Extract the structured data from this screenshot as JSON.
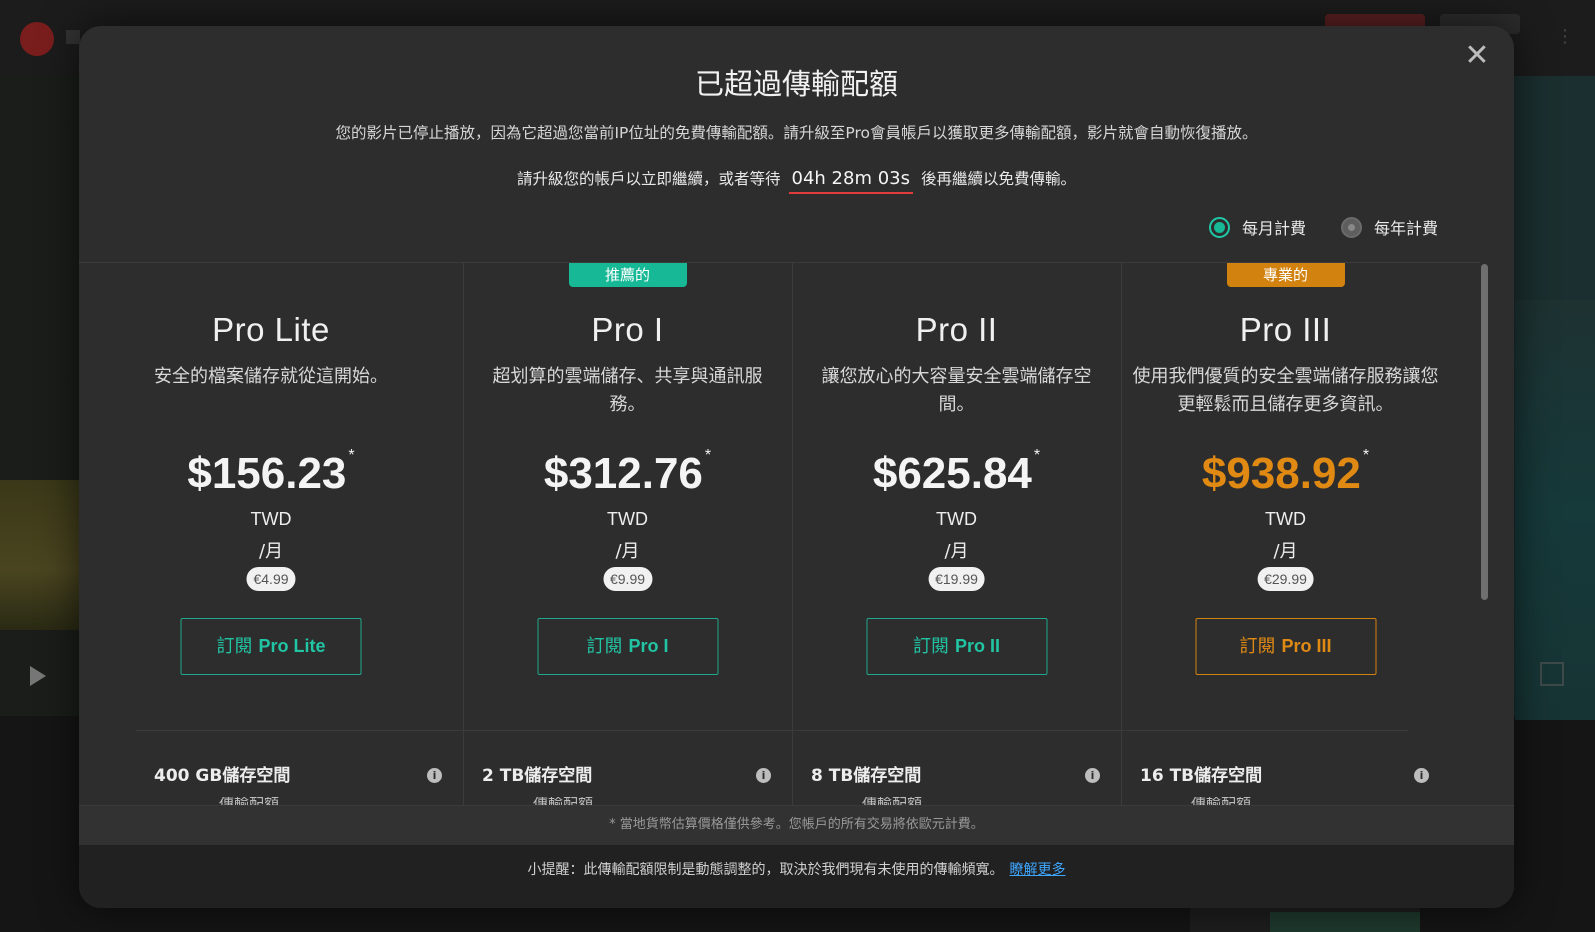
{
  "modal": {
    "title": "已超過傳輸配額",
    "description": "您的影片已停止播放，因為它超過您當前IP位址的免費傳輸配額。請升級至Pro會員帳戶以獲取更多傳輸配額，影片就會自動恢復播放。",
    "wait_prefix": "請升級您的帳戶以立即繼續，或者等待",
    "timer": "04h 28m 03s",
    "wait_suffix": "後再繼續以免費傳輸。",
    "close_icon": "✕"
  },
  "billing": {
    "monthly_label": "每月計費",
    "yearly_label": "每年計費",
    "selected": "monthly"
  },
  "plans": [
    {
      "tag": "",
      "name": "Pro Lite",
      "description": "安全的檔案儲存就從這開始。",
      "price": "$156.23",
      "asterisk": "*",
      "currency": "TWD",
      "period": "/月",
      "eur": "€4.99",
      "button_prefix": "訂閱",
      "button_plan": "Pro Lite",
      "storage": "400 GB儲存空間",
      "transfer_hint": "傳輸配額"
    },
    {
      "tag": "推薦的",
      "name": "Pro I",
      "description": "超划算的雲端儲存、共享與通訊服務。",
      "price": "$312.76",
      "asterisk": "*",
      "currency": "TWD",
      "period": "/月",
      "eur": "€9.99",
      "button_prefix": "訂閱",
      "button_plan": "Pro I",
      "storage": "2 TB儲存空間",
      "transfer_hint": "傳輸配額"
    },
    {
      "tag": "",
      "name": "Pro II",
      "description": "讓您放心的大容量安全雲端儲存空間。",
      "price": "$625.84",
      "asterisk": "*",
      "currency": "TWD",
      "period": "/月",
      "eur": "€19.99",
      "button_prefix": "訂閱",
      "button_plan": "Pro II",
      "storage": "8 TB儲存空間",
      "transfer_hint": "傳輸配額"
    },
    {
      "tag": "專業的",
      "name": "Pro III",
      "description": "使用我們優質的安全雲端儲存服務讓您更輕鬆而且儲存更多資訊。",
      "price": "$938.92",
      "asterisk": "*",
      "currency": "TWD",
      "period": "/月",
      "eur": "€29.99",
      "button_prefix": "訂閱",
      "button_plan": "Pro III",
      "storage": "16 TB儲存空間",
      "transfer_hint": "傳輸配額"
    }
  ],
  "footnote": "* 當地貨幣估算價格僅供參考。您帳戶的所有交易將依歐元計費。",
  "tip": {
    "text": "小提醒：此傳輸配額限制是動態調整的，取決於我們現有未使用的傳輸頻寬。",
    "link": "瞭解更多"
  },
  "colors": {
    "accent_green": "#1fa88c",
    "recommended_tag": "#17b896",
    "pro_tag": "#d2820e",
    "pro3_price": "#e08a14",
    "timer_underline": "#e23b3b",
    "link": "#3da6ff"
  },
  "icons": {
    "close": "close-icon",
    "info": "info-icon",
    "radio_on": "radio-selected-icon",
    "radio_off": "radio-unselected-icon"
  }
}
